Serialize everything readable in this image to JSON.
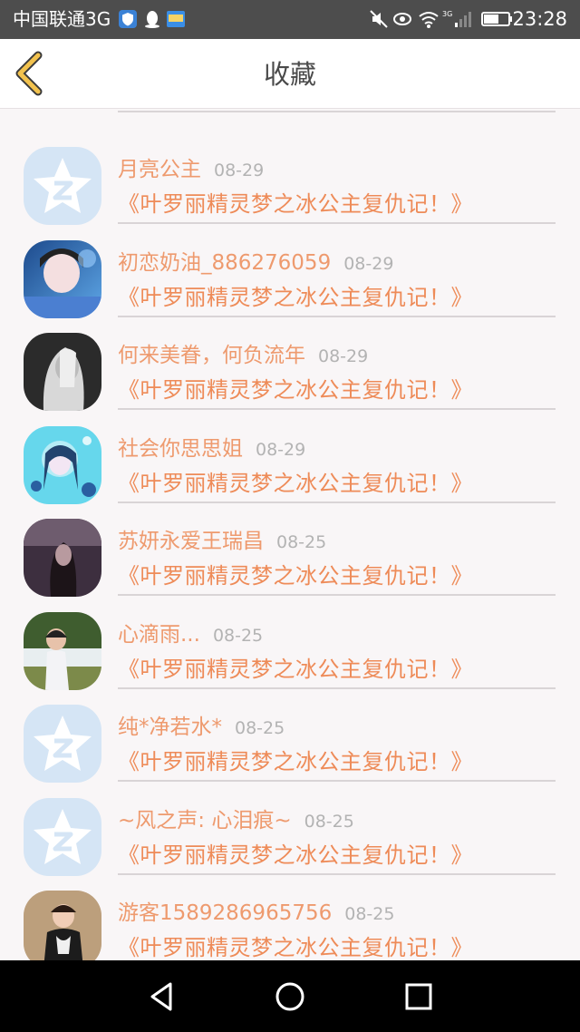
{
  "status_bar": {
    "carrier": "中国联通3G",
    "network": "3G",
    "time": "23:28"
  },
  "header": {
    "title": "收藏"
  },
  "colors": {
    "accent": "#ee8b58",
    "name": "#ee9a6e",
    "date": "#b3b3b3",
    "back_arrow": "#e8b84a"
  },
  "items": [
    {
      "name": "月亮公主",
      "date": "08-29",
      "title": "《叶罗丽精灵梦之冰公主复仇记！》",
      "avatar": "default-qzone-avatar"
    },
    {
      "name": "初恋奶油_886276059",
      "date": "08-29",
      "title": "《叶罗丽精灵梦之冰公主复仇记！》",
      "avatar": "photo-avatar-blue"
    },
    {
      "name": "何来美眷，何负流年",
      "date": "08-29",
      "title": "《叶罗丽精灵梦之冰公主复仇记！》",
      "avatar": "photo-avatar-gray"
    },
    {
      "name": "社会你思思姐",
      "date": "08-29",
      "title": "《叶罗丽精灵梦之冰公主复仇记！》",
      "avatar": "photo-avatar-cyan"
    },
    {
      "name": "苏妍永爱王瑞昌",
      "date": "08-25",
      "title": "《叶罗丽精灵梦之冰公主复仇记！》",
      "avatar": "photo-avatar-purple"
    },
    {
      "name": "心滴雨...",
      "date": "08-25",
      "title": "《叶罗丽精灵梦之冰公主复仇记！》",
      "avatar": "photo-avatar-green"
    },
    {
      "name": "纯*净若水*",
      "date": "08-25",
      "title": "《叶罗丽精灵梦之冰公主复仇记！》",
      "avatar": "default-qzone-avatar"
    },
    {
      "name": "~风之声: 心泪痕~",
      "date": "08-25",
      "title": "《叶罗丽精灵梦之冰公主复仇记！》",
      "avatar": "default-qzone-avatar"
    },
    {
      "name": "游客1589286965756",
      "date": "08-25",
      "title": "《叶罗丽精灵梦之冰公主复仇记！》",
      "avatar": "photo-avatar-warm"
    }
  ]
}
